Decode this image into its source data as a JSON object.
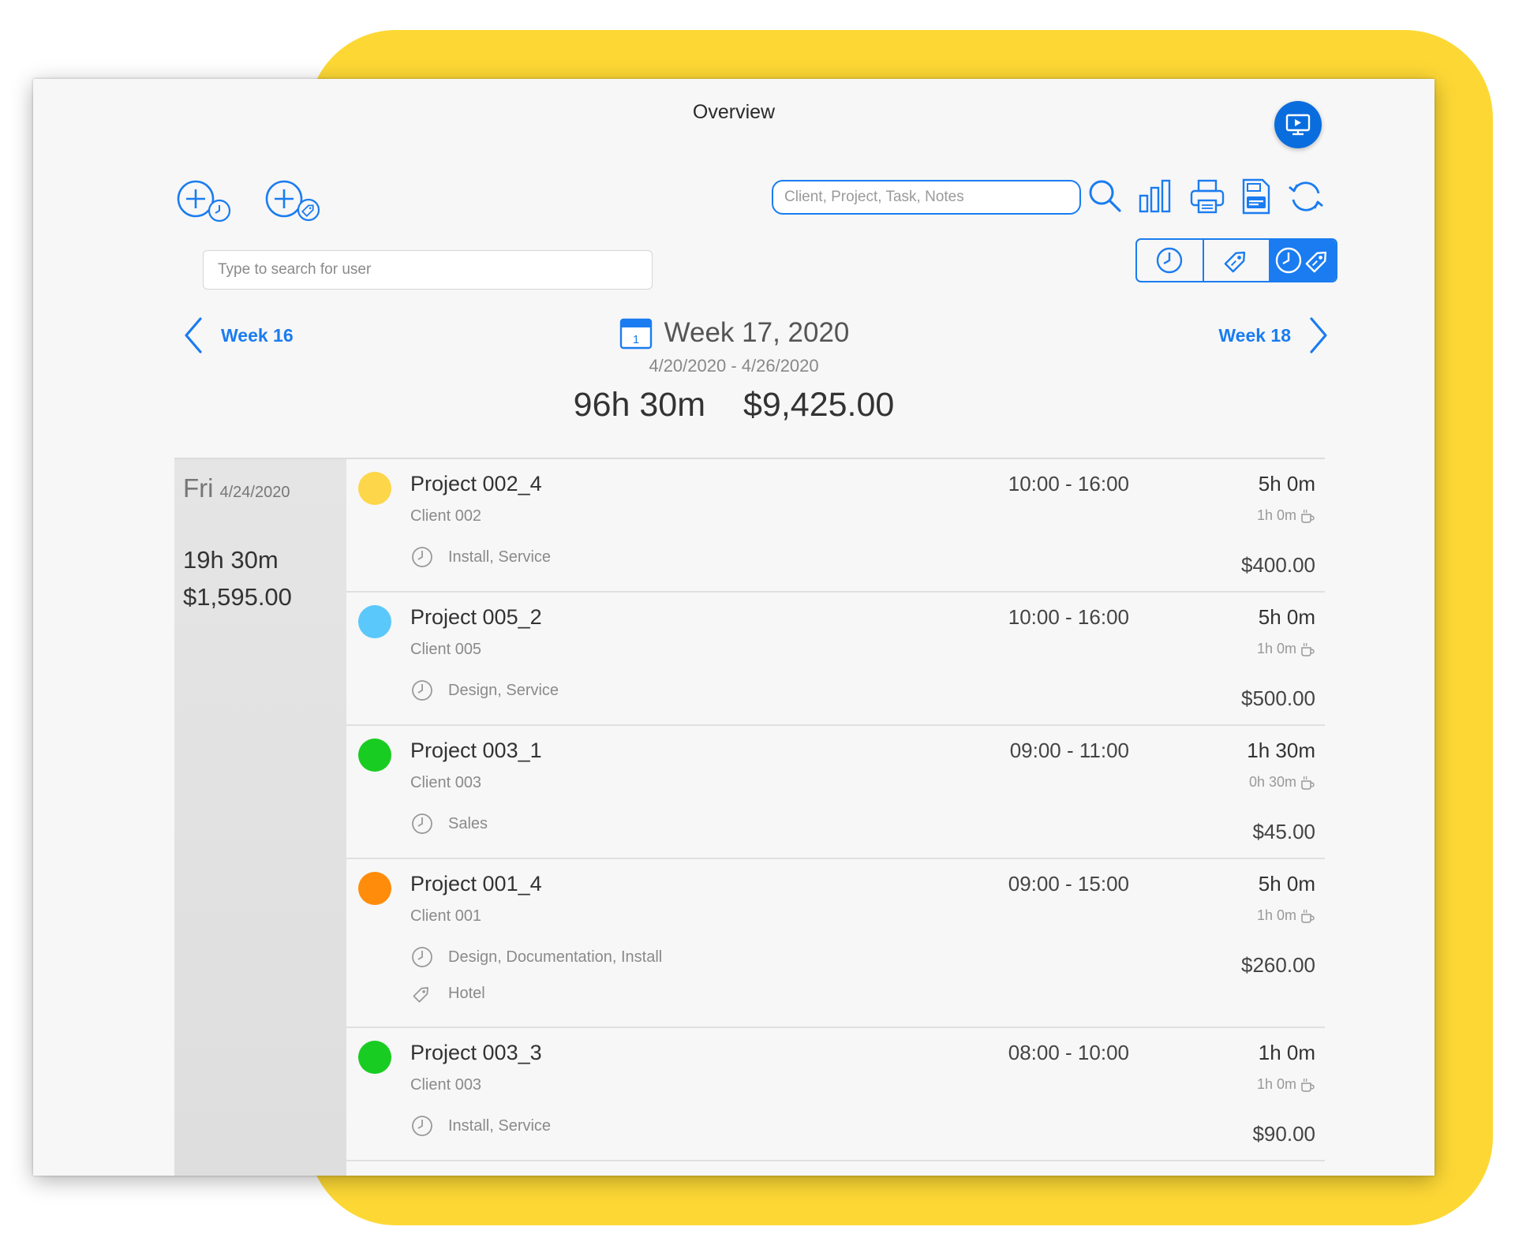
{
  "window": {
    "title": "Overview"
  },
  "toolbar": {
    "search_placeholder": "Client, Project, Task, Notes",
    "user_search_placeholder": "Type to search for user",
    "accent_color": "#1a7cf0"
  },
  "week": {
    "prev_label": "Week 16",
    "next_label": "Week 18",
    "calendar_day": "1",
    "title": "Week 17, 2020",
    "range": "4/20/2020 - 4/26/2020",
    "total_hours": "96h 30m",
    "total_amount": "$9,425.00"
  },
  "day": {
    "name": "Fri",
    "date": "4/24/2020",
    "total_hours": "19h 30m",
    "total_amount": "$1,595.00"
  },
  "entries": [
    {
      "project": "Project 002_4",
      "client": "Client 002",
      "time": "10:00 - 16:00",
      "duration": "5h 0m",
      "break": "1h 0m",
      "amount": "$400.00",
      "tasks": "Install, Service",
      "expenses": "",
      "color": "#FDD64A"
    },
    {
      "project": "Project 005_2",
      "client": "Client 005",
      "time": "10:00 - 16:00",
      "duration": "5h 0m",
      "break": "1h 0m",
      "amount": "$500.00",
      "tasks": "Design, Service",
      "expenses": "",
      "color": "#5AC8FA"
    },
    {
      "project": "Project 003_1",
      "client": "Client 003",
      "time": "09:00 - 11:00",
      "duration": "1h 30m",
      "break": "0h 30m",
      "amount": "$45.00",
      "tasks": "Sales",
      "expenses": "",
      "color": "#19CC22"
    },
    {
      "project": "Project 001_4",
      "client": "Client 001",
      "time": "09:00 - 15:00",
      "duration": "5h 0m",
      "break": "1h 0m",
      "amount": "$260.00",
      "tasks": "Design, Documentation, Install",
      "expenses": "Hotel",
      "color": "#FF8C0A"
    },
    {
      "project": "Project 003_3",
      "client": "Client 003",
      "time": "08:00 - 10:00",
      "duration": "1h 0m",
      "break": "1h 0m",
      "amount": "$90.00",
      "tasks": "Install, Service",
      "expenses": "",
      "color": "#19CC22"
    }
  ]
}
